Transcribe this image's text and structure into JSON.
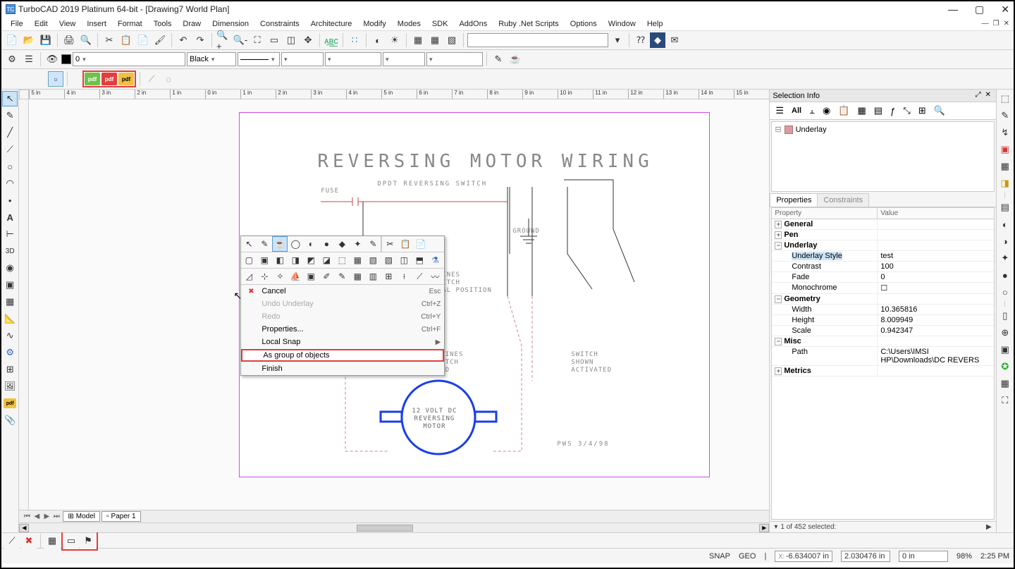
{
  "window": {
    "title": "TurboCAD 2019 Platinum 64-bit - [Drawing7 World Plan]",
    "app_icon_text": "TC"
  },
  "menus": [
    "File",
    "Edit",
    "View",
    "Insert",
    "Format",
    "Tools",
    "Draw",
    "Dimension",
    "Constraints",
    "Architecture",
    "Modify",
    "Modes",
    "SDK",
    "AddOns",
    "Ruby .Net Scripts",
    "Options",
    "Window",
    "Help"
  ],
  "toolbar1": {
    "search_placeholder": ""
  },
  "toolbar2": {
    "layer_value": "0",
    "color_name": "Black"
  },
  "drawing": {
    "title": "REVERSING MOTOR WIRING",
    "fuse_label": "FUSE",
    "switch_label": "DPDT REVERSING SWITCH",
    "ground_label": "GROUND",
    "solid_note_l1": "SOLID LINES",
    "solid_note_l2": "SHOW SWITCH",
    "solid_note_l3": "IN NORMAL POSITION",
    "dotted_note_l1": "DOTTED LINES",
    "dotted_note_l2": "SHOW SWITCH",
    "dotted_note_l3": "ACTIVATED",
    "switch_r_l1": "SWITCH",
    "switch_r_l2": "SHOWN",
    "switch_r_l3": "ACTIVATED",
    "motor_l1": "12 VOLT DC",
    "motor_l2": "REVERSING",
    "motor_l3": "MOTOR",
    "footer": "PWS  3/4/98"
  },
  "context_menu": {
    "items": [
      {
        "label": "Cancel",
        "shortcut": "Esc",
        "icon": "✖",
        "icon_color": "#d33"
      },
      {
        "label": "Undo Underlay",
        "shortcut": "Ctrl+Z",
        "disabled": true
      },
      {
        "label": "Redo",
        "shortcut": "Ctrl+Y",
        "disabled": true
      },
      {
        "label": "Properties...",
        "shortcut": "Ctrl+F"
      },
      {
        "label": "Local Snap",
        "submenu": true
      },
      {
        "label": "As group of objects",
        "highlighted": true
      },
      {
        "label": "Finish"
      }
    ]
  },
  "selection_info": {
    "title": "Selection Info",
    "all_tab": "All",
    "tree_item": "Underlay",
    "sub_tabs": [
      "Properties",
      "Constraints"
    ],
    "columns": [
      "Property",
      "Value"
    ],
    "rows": [
      {
        "type": "group",
        "name": "General",
        "expanded": false
      },
      {
        "type": "group",
        "name": "Pen",
        "expanded": false
      },
      {
        "type": "group",
        "name": "Underlay",
        "expanded": true
      },
      {
        "type": "prop",
        "indent": true,
        "name": "Underlay Style",
        "value": "test",
        "selected": true
      },
      {
        "type": "prop",
        "indent": true,
        "name": "Contrast",
        "value": "100"
      },
      {
        "type": "prop",
        "indent": true,
        "name": "Fade",
        "value": "0"
      },
      {
        "type": "prop",
        "indent": true,
        "name": "Monochrome",
        "value": "☐"
      },
      {
        "type": "group",
        "name": "Geometry",
        "expanded": true
      },
      {
        "type": "prop",
        "indent": true,
        "name": "Width",
        "value": "10.365816"
      },
      {
        "type": "prop",
        "indent": true,
        "name": "Height",
        "value": "8.009949"
      },
      {
        "type": "prop",
        "indent": true,
        "name": "Scale",
        "value": "0.942347"
      },
      {
        "type": "group",
        "name": "Misc",
        "expanded": true
      },
      {
        "type": "prop",
        "indent": true,
        "name": "Path",
        "value": "C:\\Users\\IMSI HP\\Downloads\\DC REVERS"
      },
      {
        "type": "group",
        "name": "Metrics",
        "expanded": false
      }
    ],
    "status": "1 of 452 selected:"
  },
  "bottom_tabs": [
    "Model",
    "Paper 1"
  ],
  "status_bar": {
    "snap": "SNAP",
    "geo": "GEO",
    "x_label": "X:",
    "x_value": "-6.634007 in",
    "y_label": "",
    "y_value": "2.030476 in",
    "z_label": "",
    "z_value": "0 in",
    "zoom": "98%",
    "time": "2:25 PM"
  },
  "ruler_marks": [
    "5 in",
    "4 in",
    "3 in",
    "2 in",
    "1 in",
    "0 in",
    "1 in",
    "2 in",
    "3 in",
    "4 in",
    "5 in",
    "6 in",
    "7 in",
    "8 in",
    "9 in",
    "10 in",
    "11 in",
    "12 in",
    "13 in",
    "14 in",
    "15 in"
  ]
}
